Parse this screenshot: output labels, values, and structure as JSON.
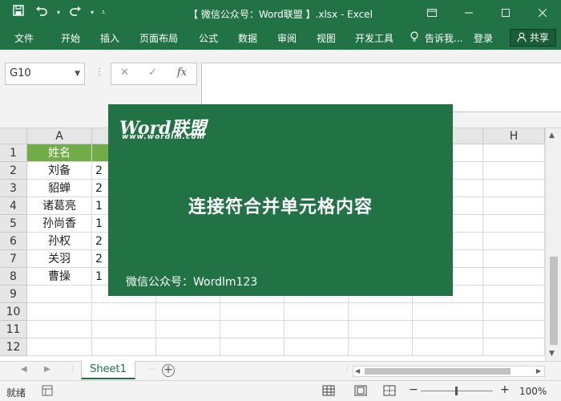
{
  "titlebar": {
    "title": "【 微信公众号：Word联盟 】.xlsx  -  Excel",
    "qat_icons": [
      "save-icon",
      "undo-icon",
      "redo-icon",
      "customize-qat-icon"
    ],
    "controls": [
      "ribbon-display-icon",
      "minimize-icon",
      "maximize-icon",
      "close-icon"
    ]
  },
  "ribbon": {
    "tabs": [
      "文件",
      "开始",
      "插入",
      "页面布局",
      "公式",
      "数据",
      "审阅",
      "视图",
      "开发工具"
    ],
    "tell_me": "告诉我...",
    "signin": "登录",
    "share": "共享"
  },
  "formula_bar": {
    "name_box": "G10",
    "formula": "",
    "fx_label": "fx"
  },
  "grid": {
    "columns": [
      "A",
      "",
      "",
      "",
      "",
      "",
      "G",
      "H"
    ],
    "rows": [
      "1",
      "2",
      "3",
      "4",
      "5",
      "6",
      "7",
      "8",
      "9",
      "10",
      "11",
      "12"
    ],
    "col_a": [
      "姓名",
      "刘备",
      "貂蝉",
      "诸葛亮",
      "孙尚香",
      "孙权",
      "关羽",
      "曹操"
    ],
    "col_b": [
      "",
      "2",
      "2",
      "1",
      "1",
      "2",
      "2",
      "1"
    ]
  },
  "overlay": {
    "logo_main": "Word联盟",
    "logo_url": "www.wordlm.com",
    "title": "连接符合并单元格内容",
    "footer": "微信公众号：Wordlm123",
    "background": "#217346"
  },
  "sheets": {
    "tabs": [
      "Sheet1"
    ],
    "active": "Sheet1"
  },
  "status": {
    "ready": "就绪",
    "zoom": "100%",
    "zoom_minus": "−",
    "zoom_plus": "+"
  },
  "colors": {
    "accent": "#217346",
    "header_fill": "#70ad47"
  }
}
